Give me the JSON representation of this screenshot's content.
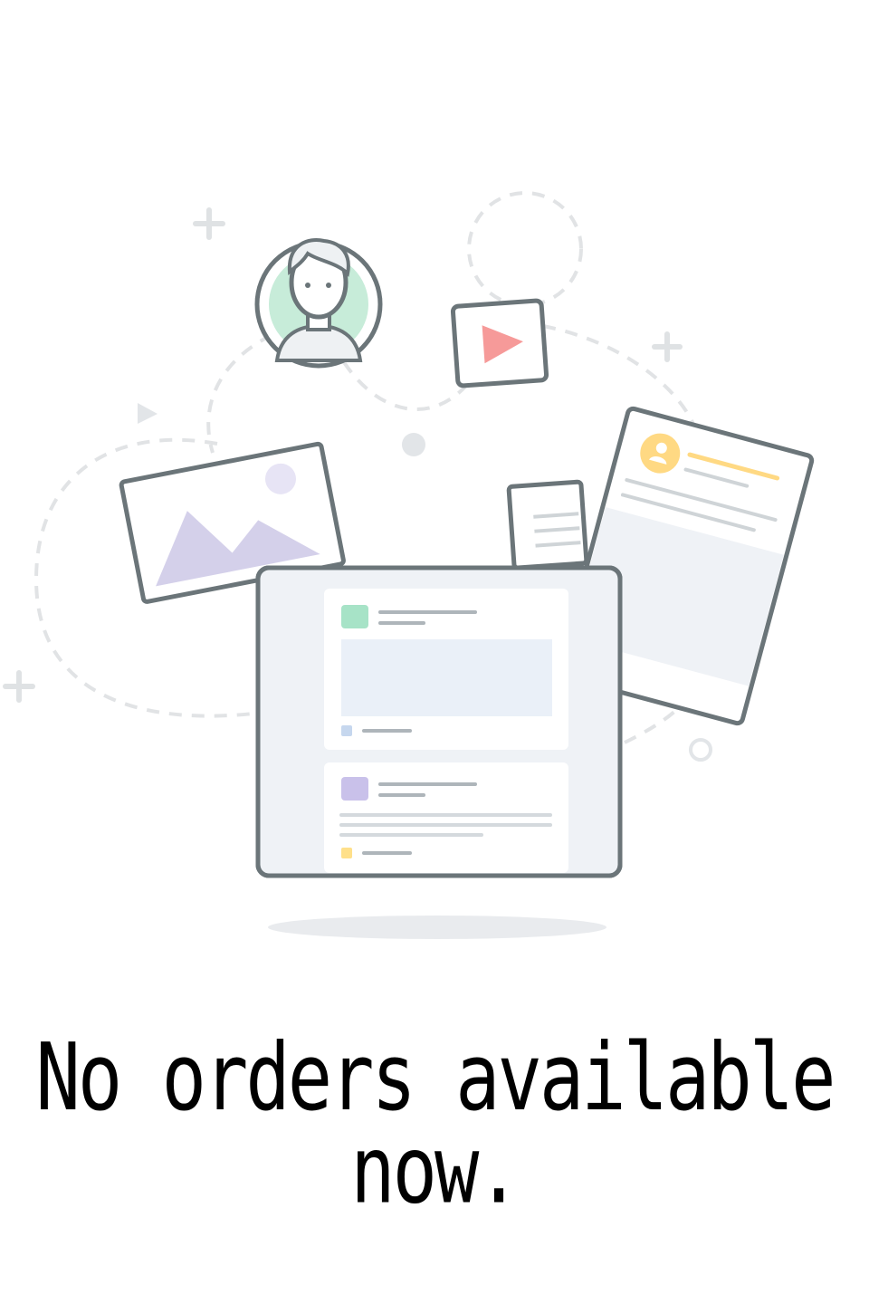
{
  "empty_state": {
    "message": "No orders available now.",
    "illustration": "empty-orders-illustration"
  },
  "colors": {
    "outline": "#6b7579",
    "dashed": "#e1e3e5",
    "avatar_green": "#c7ecd9",
    "play_red": "#f69a99",
    "mountain_purple": "#d4d0ea",
    "sun_purple": "#e7e4f5",
    "doc_yellow": "#ffd983",
    "card_bg": "#eff2f6",
    "card_inner": "#eaf0f8",
    "tag_blue": "#c6d7ee",
    "tag_yellow": "#ffe08a",
    "shadow": "#e9ebee"
  }
}
